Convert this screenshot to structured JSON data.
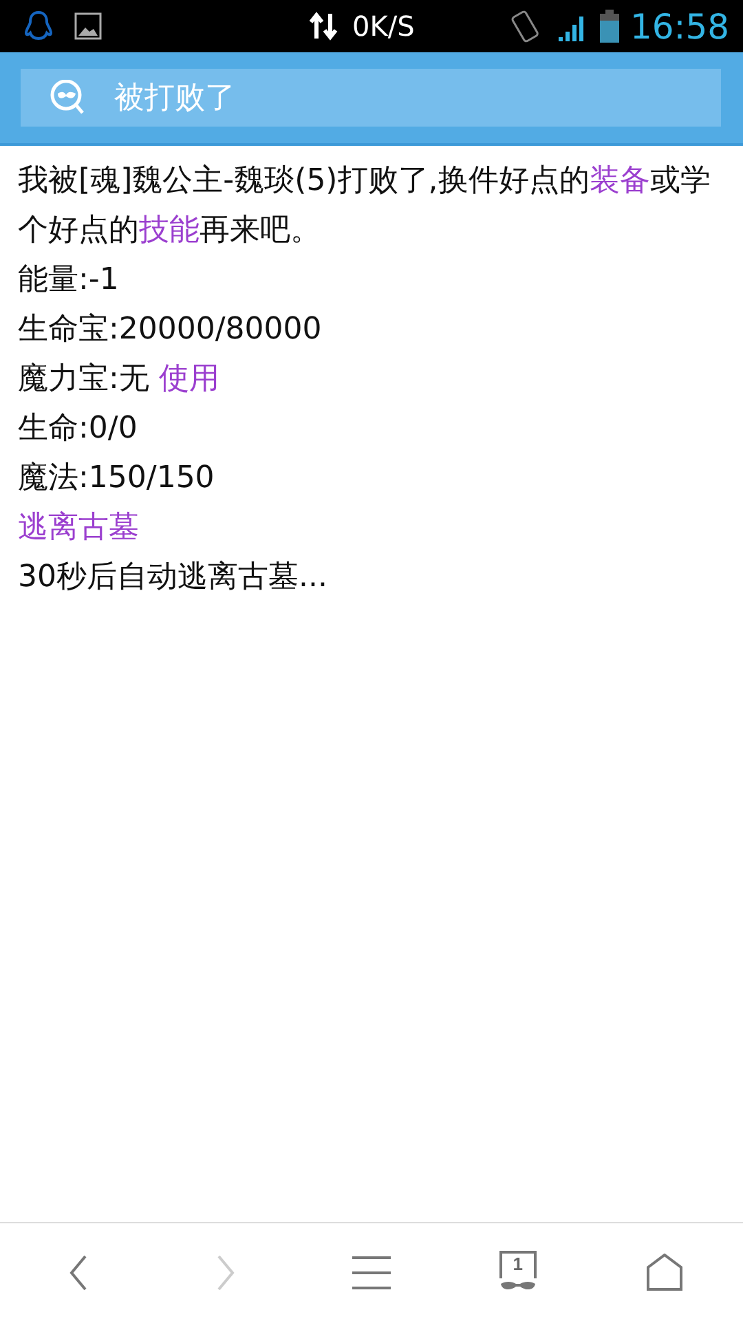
{
  "status_bar": {
    "speed": "0K/S",
    "time": "16:58"
  },
  "header": {
    "title": "被打败了"
  },
  "content": [
    {
      "kind": "para",
      "parts": [
        {
          "kind": "text",
          "text": "我被[魂]魏公主-魏琰(5)打败了,换件好点的"
        },
        {
          "kind": "link",
          "text": "装备"
        },
        {
          "kind": "text",
          "text": "或学个好点的"
        },
        {
          "kind": "link",
          "text": "技能"
        },
        {
          "kind": "text",
          "text": "再来吧。"
        }
      ]
    },
    {
      "kind": "para",
      "parts": [
        {
          "kind": "text",
          "text": "能量:-1"
        }
      ]
    },
    {
      "kind": "para",
      "parts": [
        {
          "kind": "text",
          "text": "生命宝:20000/80000"
        }
      ]
    },
    {
      "kind": "para",
      "parts": [
        {
          "kind": "text",
          "text": "魔力宝:无 "
        },
        {
          "kind": "link",
          "text": "使用"
        }
      ]
    },
    {
      "kind": "para",
      "parts": [
        {
          "kind": "text",
          "text": "生命:0/0"
        }
      ]
    },
    {
      "kind": "para",
      "parts": [
        {
          "kind": "text",
          "text": "魔法:150/150"
        }
      ]
    },
    {
      "kind": "para",
      "parts": [
        {
          "kind": "link",
          "text": "逃离古墓"
        }
      ]
    },
    {
      "kind": "para",
      "parts": [
        {
          "kind": "text",
          "text": "30秒后自动逃离古墓..."
        }
      ]
    }
  ],
  "nav": {
    "back_disabled": false,
    "forward_disabled": true,
    "tab_count": "1"
  }
}
